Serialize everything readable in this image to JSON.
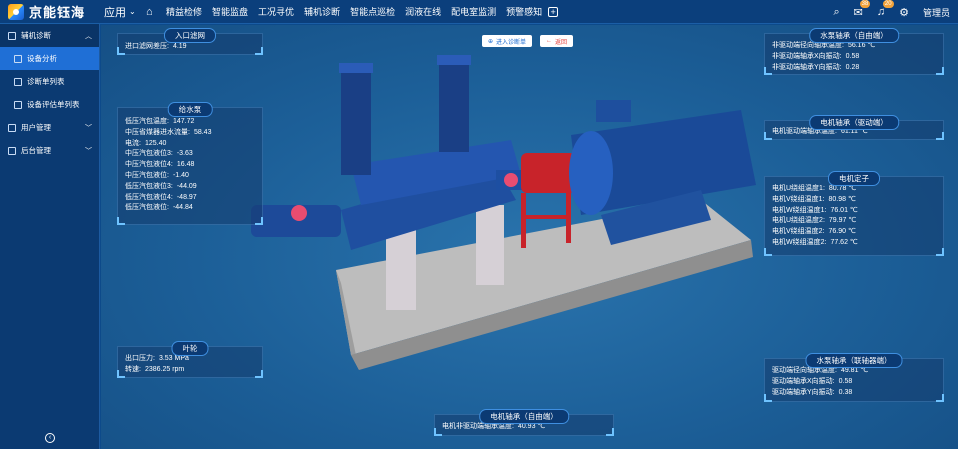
{
  "header": {
    "logo_text": "京能钰海",
    "apps_label": "应用",
    "nav": [
      "精益检修",
      "智能监盘",
      "工况寻优",
      "辅机诊断",
      "智能点巡检",
      "润液在线",
      "配电室监测",
      "预警感知"
    ],
    "badge_1": "38",
    "badge_2": "20",
    "user": "管理员"
  },
  "sidebar": {
    "group": "辅机诊断",
    "items": [
      {
        "label": "设备分析",
        "active": true
      },
      {
        "label": "诊断单列表"
      },
      {
        "label": "设备评估单列表"
      }
    ],
    "group2": "用户管理",
    "group3": "后台管理"
  },
  "toolbar": {
    "enter_label": "进入诊断单",
    "back_label": "返回"
  },
  "panels": {
    "inlet": {
      "title": "入口滤网",
      "rows": [
        {
          "k": "进口滤网差压:",
          "v": "4.19"
        }
      ]
    },
    "feedpump": {
      "title": "给水泵",
      "rows": [
        {
          "k": "低压汽包温度:",
          "v": "147.72"
        },
        {
          "k": "中压省煤器进水流量:",
          "v": "58.43"
        },
        {
          "k": "电流:",
          "v": "125.40"
        },
        {
          "k": "中压汽包液位3:",
          "v": "-3.63"
        },
        {
          "k": "中压汽包液位4:",
          "v": "16.48"
        },
        {
          "k": "中压汽包液位:",
          "v": "-1.40"
        },
        {
          "k": "低压汽包液位3:",
          "v": "-44.09"
        },
        {
          "k": "低压汽包液位4:",
          "v": "-48.97"
        },
        {
          "k": "低压汽包液位:",
          "v": "-44.84"
        }
      ]
    },
    "impeller": {
      "title": "叶轮",
      "rows": [
        {
          "k": "出口压力:",
          "v": "3.53 MPa"
        },
        {
          "k": "转速:",
          "v": "2386.25 rpm"
        }
      ]
    },
    "pump_bearing_free": {
      "title": "水泵轴承（自由端）",
      "rows": [
        {
          "k": "非驱动端径向轴承温度:",
          "v": "56.16 ℃"
        },
        {
          "k": "非驱动端轴承X向振动:",
          "v": "0.58"
        },
        {
          "k": "非驱动端轴承Y向振动:",
          "v": "0.28"
        }
      ]
    },
    "motor_bearing_drive": {
      "title": "电机轴承（驱动端）",
      "rows": [
        {
          "k": "电机驱动端轴承温度:",
          "v": "61.11 ℃"
        }
      ]
    },
    "stator": {
      "title": "电机定子",
      "rows": [
        {
          "k": "电机U绕组温度1:",
          "v": "80.78 ℃"
        },
        {
          "k": "电机V绕组温度1:",
          "v": "80.98 ℃"
        },
        {
          "k": "电机W绕组温度1:",
          "v": "76.01 ℃"
        },
        {
          "k": "电机U绕组温度2:",
          "v": "79.97 ℃"
        },
        {
          "k": "电机V绕组温度2:",
          "v": "76.90 ℃"
        },
        {
          "k": "电机W绕组温度2:",
          "v": "77.62 ℃"
        }
      ]
    },
    "pump_bearing_coupling": {
      "title": "水泵轴承（联轴器端）",
      "rows": [
        {
          "k": "驱动端径向轴承温度:",
          "v": "49.81 ℃"
        },
        {
          "k": "驱动端轴承X向振动:",
          "v": "0.58"
        },
        {
          "k": "驱动端轴承Y向振动:",
          "v": "0.38"
        }
      ]
    },
    "motor_bearing_free": {
      "title": "电机轴承（自由端）",
      "rows": [
        {
          "k": "电机非驱动端轴承温度:",
          "v": "40.93 ℃"
        }
      ]
    }
  }
}
